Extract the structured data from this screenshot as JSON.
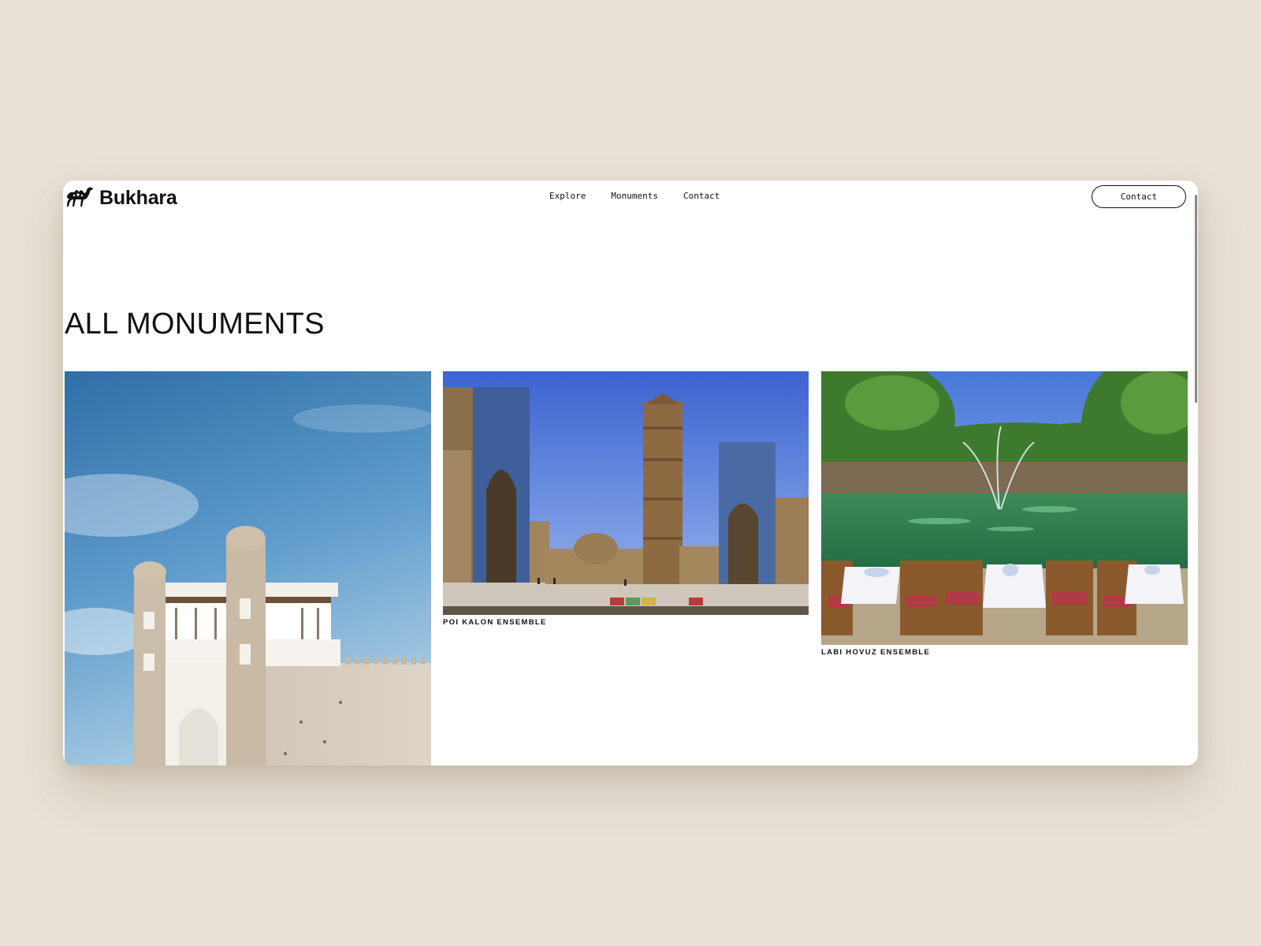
{
  "brand": {
    "name": "Bukhara",
    "logo": "camel-icon"
  },
  "nav": {
    "links": [
      {
        "label": "Explore"
      },
      {
        "label": "Monuments"
      },
      {
        "label": "Contact"
      }
    ],
    "cta_label": "Contact"
  },
  "page": {
    "title": "ALL MONUMENTS"
  },
  "monuments": [
    {
      "label": "",
      "image": "ark-fortress-photo"
    },
    {
      "label": "POI KALON ENSEMBLE",
      "image": "poi-kalon-photo"
    },
    {
      "label": "LABI HOVUZ ENSEMBLE",
      "image": "labi-hovuz-photo"
    }
  ],
  "colors": {
    "background": "#e8e1d6",
    "window": "#ffffff",
    "text": "#111111"
  }
}
